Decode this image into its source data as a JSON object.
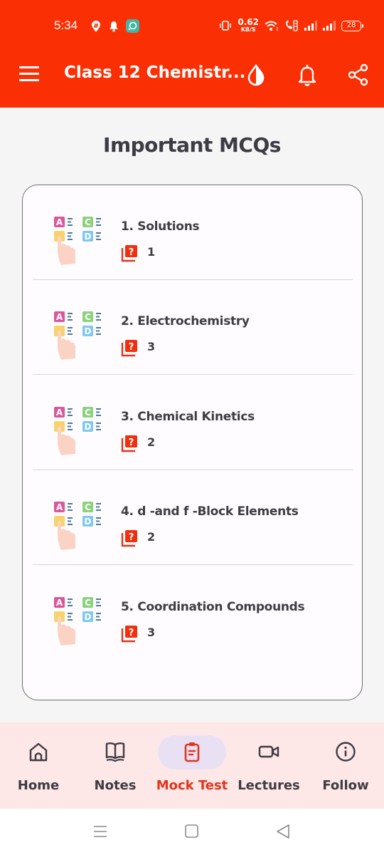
{
  "status_bar": {
    "time": "5:34",
    "left_icons": [
      "swiggy-icon",
      "bell-notification-icon",
      "app-notification-icon"
    ],
    "right_icons": [
      "vibrate-icon",
      "network-speed",
      "wifi-icon",
      "volte-icon",
      "signal-1-icon",
      "signal-2-icon",
      "battery-icon"
    ],
    "network_speed_value": "0.62",
    "network_speed_unit": "KB/S",
    "battery_level": "28"
  },
  "app_bar": {
    "title": "Class 12 Chemistr...",
    "icons": [
      "menu-icon",
      "theme-contrast-icon",
      "bell-icon",
      "share-icon"
    ],
    "brand_color": "#fa2f03"
  },
  "page": {
    "title": "Important MCQs"
  },
  "mcq_list": [
    {
      "title": "1. Solutions",
      "count": "1"
    },
    {
      "title": "2. Electrochemistry",
      "count": "3"
    },
    {
      "title": "3. Chemical Kinetics",
      "count": "2"
    },
    {
      "title": "4. d -and f -Block Elements",
      "count": "2"
    },
    {
      "title": "5. Coordination Compounds",
      "count": "3"
    }
  ],
  "bottom_nav": {
    "items": [
      {
        "label": "Home",
        "icon": "home-icon",
        "active": false
      },
      {
        "label": "Notes",
        "icon": "book-icon",
        "active": false
      },
      {
        "label": "Mock Test",
        "icon": "clipboard-icon",
        "active": true
      },
      {
        "label": "Lectures",
        "icon": "video-camera-icon",
        "active": false
      },
      {
        "label": "Follow",
        "icon": "info-icon",
        "active": false
      }
    ],
    "active_color": "#e2341c"
  },
  "system_nav": {
    "buttons": [
      "recents-icon",
      "home-square-icon",
      "back-triangle-icon"
    ]
  }
}
